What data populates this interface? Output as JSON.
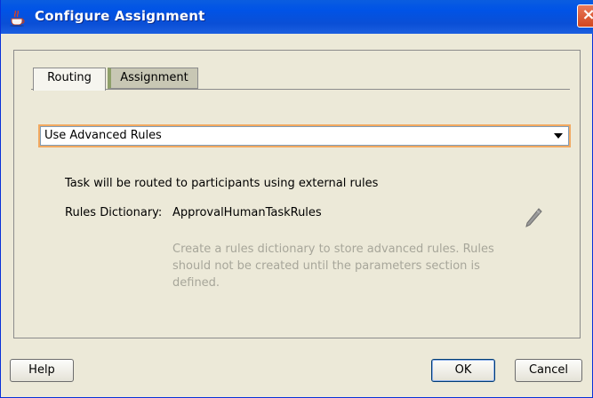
{
  "window": {
    "title": "Configure Assignment",
    "close_glyph": "×"
  },
  "tabs": [
    {
      "label": "Routing",
      "selected": true
    },
    {
      "label": "Assignment",
      "selected": false
    }
  ],
  "routing": {
    "mode_select": {
      "value": "Use Advanced Rules"
    },
    "description": "Task will be routed to participants using external rules",
    "rules_dictionary": {
      "label": "Rules Dictionary:",
      "value": "ApprovalHumanTaskRules"
    },
    "hint": "Create a rules dictionary to store advanced rules. Rules should not be created until the parameters section is defined."
  },
  "buttons": {
    "help": "Help",
    "ok": "OK",
    "cancel": "Cancel"
  },
  "icons": {
    "title_icon": "java-cup-icon",
    "edit_icon": "pencil-icon",
    "dropdown_icon": "dropdown-arrow-icon"
  },
  "colors": {
    "titlebar": "#0053e6",
    "dialog_background": "#ece9d8",
    "focus_ring": "#f2a960",
    "hint_text": "#a7a69a"
  }
}
